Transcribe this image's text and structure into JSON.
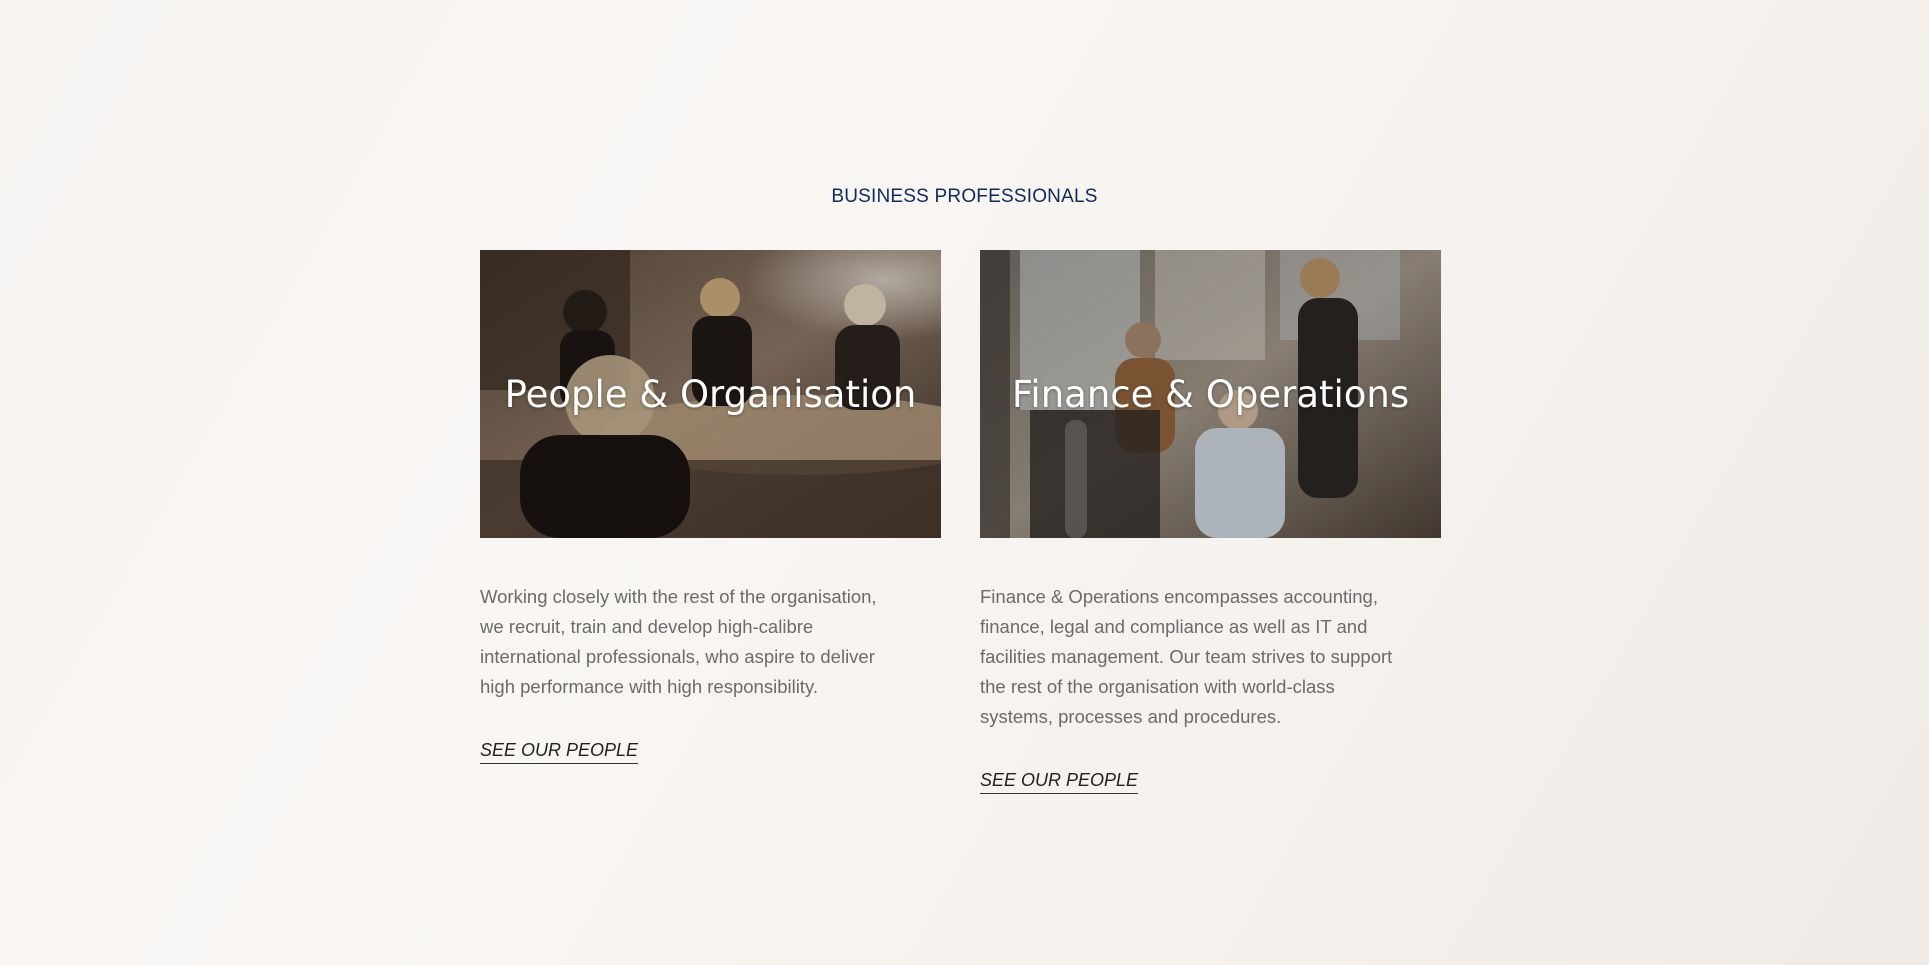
{
  "section": {
    "title": "BUSINESS PROFESSIONALS"
  },
  "cards": [
    {
      "heading": "People & Organisation",
      "description": "Working closely with the rest of the organisation, we recruit, train and develop high-calibre international professionals, who aspire to deliver high performance with high responsibility.",
      "link_label": "SEE OUR PEOPLE"
    },
    {
      "heading": "Finance & Operations",
      "description": "Finance & Operations encompasses accounting, finance, legal and compliance as well as IT and facilities management. Our team strives to support the rest of the organisation with world-class systems, processes and procedures.",
      "link_label": "SEE OUR PEOPLE"
    }
  ],
  "colors": {
    "title": "#0f2b5c",
    "body_text": "#6b6b6b",
    "link": "#222222"
  }
}
